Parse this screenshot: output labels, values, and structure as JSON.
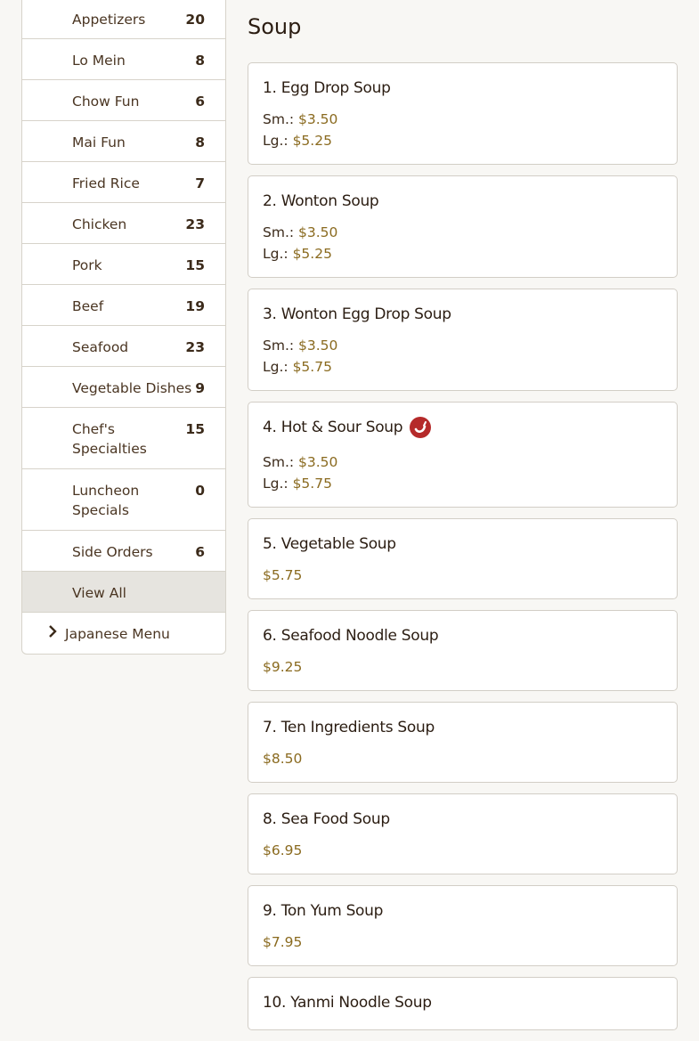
{
  "categories": [
    {
      "label": "Appetizers",
      "count": "20"
    },
    {
      "label": "Lo Mein",
      "count": "8"
    },
    {
      "label": "Chow Fun",
      "count": "6"
    },
    {
      "label": "Mai Fun",
      "count": "8"
    },
    {
      "label": "Fried Rice",
      "count": "7"
    },
    {
      "label": "Chicken",
      "count": "23"
    },
    {
      "label": "Pork",
      "count": "15"
    },
    {
      "label": "Beef",
      "count": "19"
    },
    {
      "label": "Seafood",
      "count": "23"
    },
    {
      "label": "Vegetable Dishes",
      "count": "9"
    },
    {
      "label": "Chef's Specialties",
      "count": "15"
    },
    {
      "label": "Luncheon Specials",
      "count": "0"
    },
    {
      "label": "Side Orders",
      "count": "6"
    }
  ],
  "view_all": "View All",
  "japanese_menu": "Japanese Menu",
  "section_title": "Soup",
  "small_label": "Sm.:",
  "large_label": "Lg.:",
  "items": [
    {
      "name": "1. Egg Drop Soup",
      "small": "$3.50",
      "large": "$5.25"
    },
    {
      "name": "2. Wonton Soup",
      "small": "$3.50",
      "large": "$5.25"
    },
    {
      "name": "3. Wonton Egg Drop Soup",
      "small": "$3.50",
      "large": "$5.75"
    },
    {
      "name": "4. Hot & Sour Soup",
      "small": "$3.50",
      "large": "$5.75",
      "icon": "spicy-pepper-icon"
    },
    {
      "name": "5. Vegetable Soup",
      "price": "$5.75"
    },
    {
      "name": "6. Seafood Noodle Soup",
      "price": "$9.25"
    },
    {
      "name": "7. Ten Ingredients Soup",
      "price": "$8.50"
    },
    {
      "name": "8. Sea Food Soup",
      "price": "$6.95"
    },
    {
      "name": "9. Ton Yum Soup",
      "price": "$7.95"
    },
    {
      "name": "10. Yanmi Noodle Soup"
    }
  ],
  "colors": {
    "price": "#8a6a1f",
    "spicy": "#b52a2a",
    "active_bg": "#e6e4df"
  }
}
